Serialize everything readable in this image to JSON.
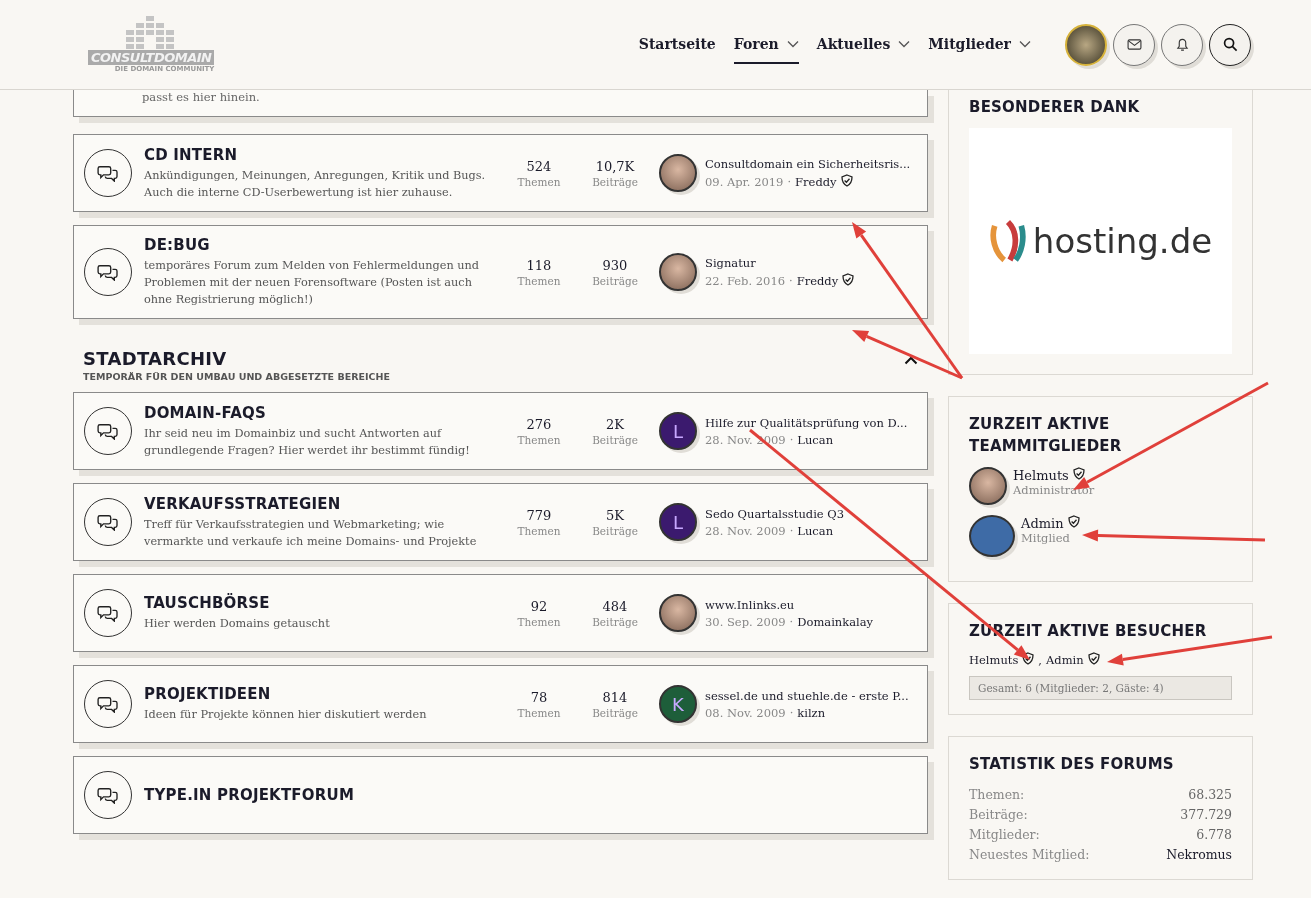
{
  "header": {
    "logo": {
      "name": "CONSULTDOMAIN",
      "tagline": "DIE DOMAIN COMMUNITY"
    },
    "nav": [
      {
        "label": "Startseite",
        "selected": false,
        "dropdown": false
      },
      {
        "label": "Foren",
        "selected": true,
        "dropdown": true
      },
      {
        "label": "Aktuelles",
        "selected": false,
        "dropdown": true
      },
      {
        "label": "Mitglieder",
        "selected": false,
        "dropdown": true
      }
    ]
  },
  "top_card": {
    "description": "passt es hier hinein."
  },
  "sections": [
    {
      "forums": [
        {
          "title": "CD INTERN",
          "description": "Ankündigungen, Meinungen, Anregungen, Kritik und Bugs. Auch die interne CD-Userbewertung ist hier zuhause.",
          "topics": "524",
          "topics_label": "Themen",
          "posts": "10,7K",
          "posts_label": "Beiträge",
          "last_post": {
            "title": "Consultdomain ein Sicherheitsris...",
            "date": "09. Apr. 2019",
            "separator": "·",
            "user": "Freddy",
            "staff": true,
            "avatar": {
              "kind": "photo"
            }
          }
        },
        {
          "title": "DE:BUG",
          "description": "temporäres Forum zum Melden von Fehlermeldungen und Problemen mit der neuen Forensoftware (Posten ist auch ohne Registrierung möglich!)",
          "topics": "118",
          "topics_label": "Themen",
          "posts": "930",
          "posts_label": "Beiträge",
          "last_post": {
            "title": "Signatur",
            "date": "22. Feb. 2016",
            "separator": "·",
            "user": "Freddy",
            "staff": true,
            "avatar": {
              "kind": "photo"
            }
          }
        }
      ]
    },
    {
      "title": "STADTARCHIV",
      "subtitle": "TEMPORÄR FÜR DEN UMBAU UND ABGESETZTE BEREICHE",
      "expanded": true,
      "forums": [
        {
          "title": "DOMAIN-FAQS",
          "description": "Ihr seid neu im Domainbiz und sucht Antworten auf grundlegende Fragen? Hier werdet ihr bestimmt fündig!",
          "topics": "276",
          "topics_label": "Themen",
          "posts": "2K",
          "posts_label": "Beiträge",
          "last_post": {
            "title": "Hilfe zur Qualitätsprüfung von D...",
            "date": "28. Nov. 2009",
            "separator": "·",
            "user": "Lucan",
            "staff": false,
            "avatar": {
              "kind": "letter",
              "letter": "L",
              "color": "#3b1a6e"
            }
          }
        },
        {
          "title": "VERKAUFSSTRATEGIEN",
          "description": "Treff für Verkaufsstrategien und Webmarketing; wie vermarkte und verkaufe ich meine Domains- und Projekte",
          "topics": "779",
          "topics_label": "Themen",
          "posts": "5K",
          "posts_label": "Beiträge",
          "last_post": {
            "title": "Sedo Quartalsstudie Q3",
            "date": "28. Nov. 2009",
            "separator": "·",
            "user": "Lucan",
            "staff": false,
            "avatar": {
              "kind": "letter",
              "letter": "L",
              "color": "#3b1a6e"
            }
          }
        },
        {
          "title": "TAUSCHBÖRSE",
          "description": "Hier werden Domains getauscht",
          "topics": "92",
          "topics_label": "Themen",
          "posts": "484",
          "posts_label": "Beiträge",
          "last_post": {
            "title": "www.Inlinks.eu",
            "date": "30. Sep. 2009",
            "separator": "·",
            "user": "Domainkalay",
            "staff": false,
            "avatar": {
              "kind": "photo"
            }
          }
        },
        {
          "title": "PROJEKTIDEEN",
          "description": "Ideen für Projekte können hier diskutiert werden",
          "topics": "78",
          "topics_label": "Themen",
          "posts": "814",
          "posts_label": "Beiträge",
          "last_post": {
            "title": "sessel.de und stuehle.de - erste P...",
            "date": "08. Nov. 2009",
            "separator": "·",
            "user": "kilzn",
            "staff": false,
            "avatar": {
              "kind": "letter",
              "letter": "K",
              "color": "#1e5e3a"
            }
          }
        },
        {
          "title": "TYPE.IN PROJEKTFORUM"
        }
      ]
    }
  ],
  "sidebar": {
    "thanks": {
      "title": "BESONDERER DANK",
      "ad_text": "hosting.de"
    },
    "team": {
      "title": "ZURZEIT AKTIVE TEAMMITGLIEDER",
      "members": [
        {
          "name": "Helmuts",
          "role": "Administrator",
          "staff": true,
          "avatar": {
            "kind": "photo"
          }
        },
        {
          "name": "Admin",
          "role": "Mitglied",
          "staff": true,
          "avatar": {
            "kind": "logo"
          }
        }
      ]
    },
    "visitors": {
      "title": "ZURZEIT AKTIVE BESUCHER",
      "users": [
        {
          "name": "Helmuts",
          "staff": true
        },
        {
          "name": "Admin",
          "staff": true
        }
      ],
      "separator": ",",
      "total": "Gesamt: 6 (Mitglieder: 2, Gäste: 4)"
    },
    "stats": {
      "title": "STATISTIK DES FORUMS",
      "rows": [
        {
          "label": "Themen:",
          "value": "68.325",
          "kind": "number"
        },
        {
          "label": "Beiträge:",
          "value": "377.729",
          "kind": "number"
        },
        {
          "label": "Mitglieder:",
          "value": "6.778",
          "kind": "number"
        },
        {
          "label": "Neuestes Mitglied:",
          "value": "Nekromus",
          "kind": "user"
        }
      ]
    }
  }
}
